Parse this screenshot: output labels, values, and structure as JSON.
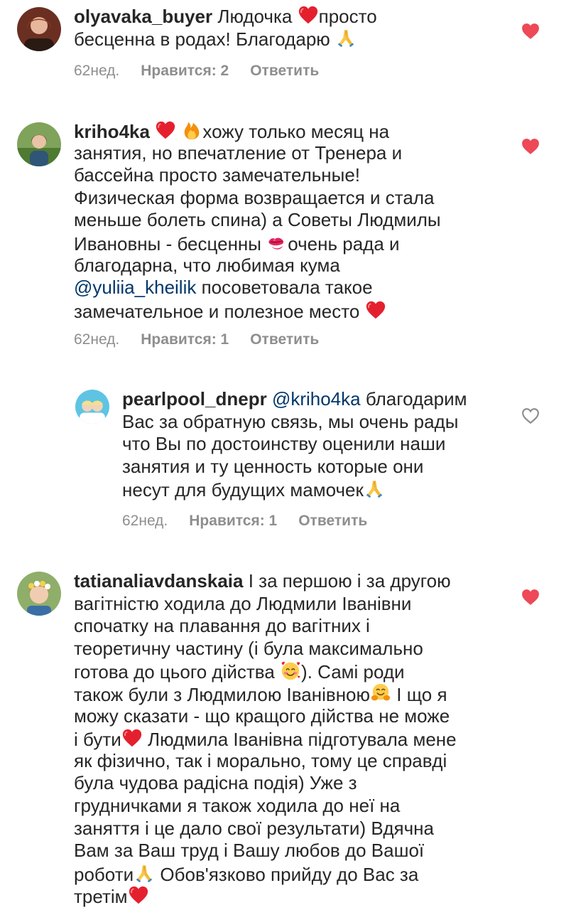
{
  "comments": [
    {
      "username": "olyavaka_buyer",
      "lines": [
        "Людочка",
        "просто",
        "бесценна в родах! Благодарю"
      ],
      "time": "62нед.",
      "likes_label": "Нравится: 2",
      "reply_label": "Ответить",
      "liked": true
    },
    {
      "username": "kriho4ka",
      "lines": [
        "хожу только месяц на",
        "занятия, но впечатление от Тренера и",
        "бассейна просто замечательные!",
        "Физическая форма возвращается и стала",
        "меньше болеть спина) а Советы Людмилы",
        "Ивановны - бесценны",
        "очень рада и",
        "благодарна, что любимая кума",
        "@yuliia_kheilik",
        "посоветовала такое",
        "замечательное и полезное место"
      ],
      "time": "62нед.",
      "likes_label": "Нравится: 1",
      "reply_label": "Ответить",
      "liked": true
    },
    {
      "username": "pearlpool_dnepr",
      "lines": [
        "@kriho4ka",
        "благодарим",
        "Вас за обратную связь, мы очень рады",
        "что Вы по достоинству оценили наши",
        "занятия и ту ценность которые они",
        "несут для будущих мамочек"
      ],
      "time": "62нед.",
      "likes_label": "Нравится: 1",
      "reply_label": "Ответить",
      "liked": false
    },
    {
      "username": "tatianaliavdanskaia",
      "lines": [
        "І за першою і за другою",
        "вагітністю ходила до Людмили Іванівни",
        "спочатку  на плавання до вагітних і",
        "теоретичну частину (і була максимально",
        "готова до цього дійства",
        "). Самі роди",
        "також були з Людмилою Іванівною",
        "І що я",
        "можу сказати - що кращого дійства не може",
        "і бути",
        "Людмила Іванівна підготувала мене",
        "як фізично, так і морально, тому це справді",
        "була чудова радісна подія) Уже з",
        "грудничками я також ходила до неї на",
        "заняття і це дало свої  результати) Вдячна",
        "Вам за Ваш труд і Вашу любов до Вашої",
        "роботи",
        "Обов'язково прийду до Вас за",
        "третім"
      ],
      "liked": true
    }
  ],
  "colors": {
    "text": "#262626",
    "meta": "#8e8e8e",
    "mention": "#00376b",
    "heart_liked": "#ed4956",
    "heart_outline": "#8e8e8e"
  },
  "icons": [
    "heart-emoji",
    "fire-emoji",
    "pray-emoji",
    "kiss-mark-emoji",
    "smiling-hearts-emoji",
    "hugging-emoji",
    "like-heart-icon"
  ]
}
